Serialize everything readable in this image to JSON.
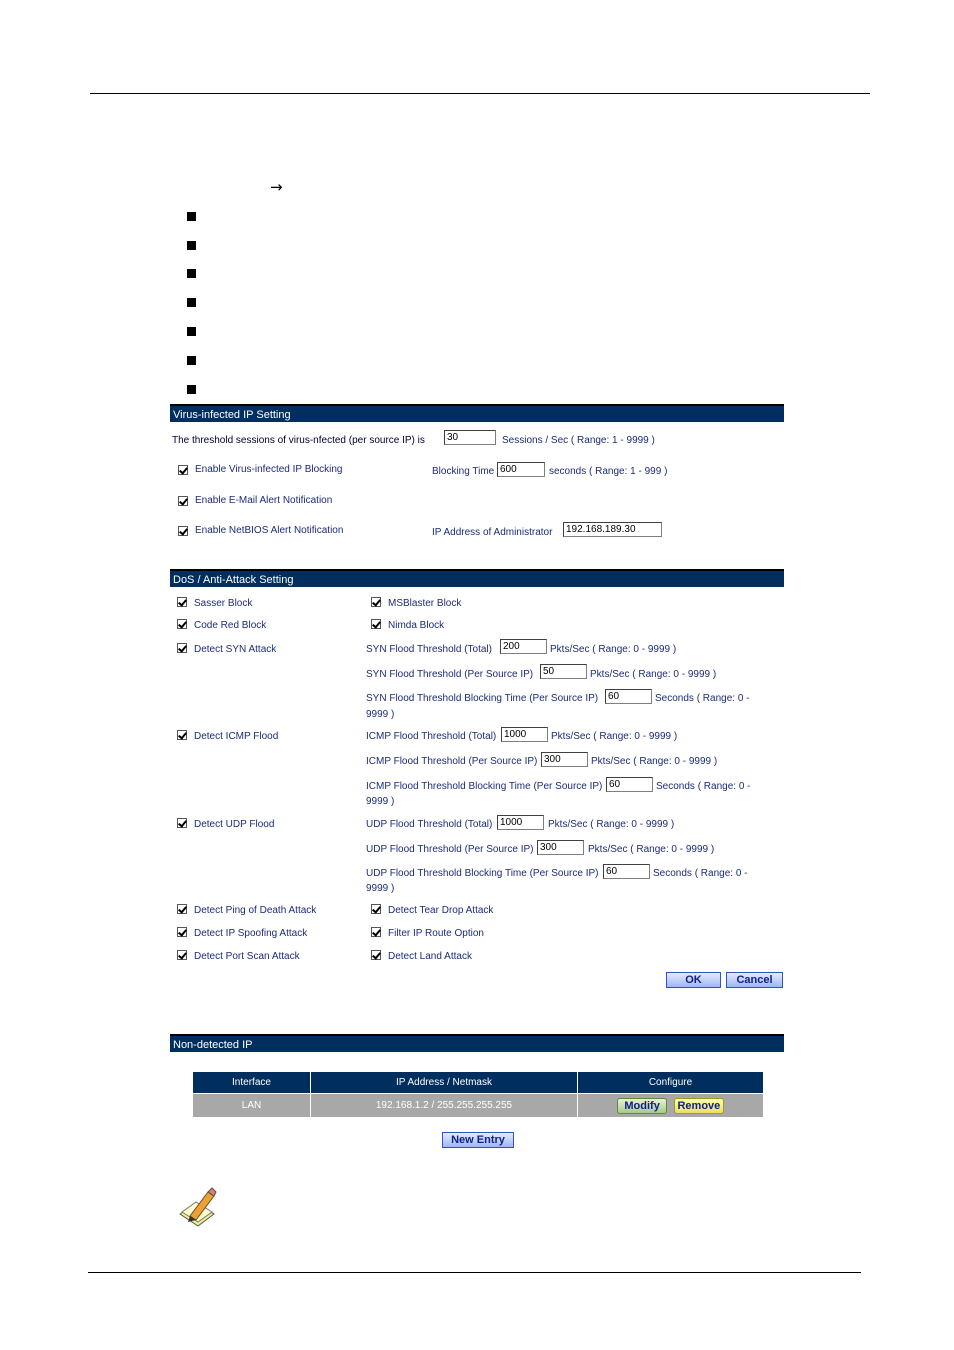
{
  "doc": {
    "arrow_icon": "right-arrow",
    "bullet_count": 7,
    "note_icon": "pencil-note-icon"
  },
  "virus": {
    "header": "Virus-infected IP Setting",
    "threshold_label": "The threshold sessions of virus-nfected (per source IP) is",
    "threshold_value": "30",
    "threshold_unit": "Sessions / Sec  ( Range: 1 - 9999 )",
    "blocking_label": "Enable Virus-infected IP Blocking",
    "blocking_checked": true,
    "blocking_time_label": "Blocking Time",
    "blocking_time_value": "600",
    "blocking_time_unit": "seconds  ( Range: 1 - 999 )",
    "email_label": "Enable E-Mail Alert Notification",
    "email_checked": true,
    "netbios_label": "Enable NetBIOS Alert Notification",
    "netbios_checked": true,
    "admin_ip_label": "IP Address of Administrator",
    "admin_ip_value": "192.168.189.30"
  },
  "dos": {
    "header": "DoS / Anti-Attack Setting",
    "sasser": "Sasser Block",
    "msblaster": "MSBlaster Block",
    "codered": "Code Red Block",
    "nimda": "Nimda Block",
    "syn": {
      "label": "Detect SYN Attack",
      "total_label": "SYN Flood Threshold (Total)",
      "total_value": "200",
      "total_unit": "Pkts/Sec  ( Range: 0 - 9999 )",
      "per_label": "SYN Flood Threshold (Per Source IP)",
      "per_value": "50",
      "per_unit": "Pkts/Sec  ( Range: 0 - 9999 )",
      "block_label": "SYN Flood Threshold Blocking Time (Per Source IP)",
      "block_value": "60",
      "block_unit": "Seconds  ( Range: 0 -",
      "block_unit2": "9999 )"
    },
    "icmp": {
      "label": "Detect ICMP Flood",
      "total_label": "ICMP Flood Threshold (Total)",
      "total_value": "1000",
      "total_unit": "Pkts/Sec  ( Range: 0 - 9999 )",
      "per_label": "ICMP Flood Threshold (Per Source IP)",
      "per_value": "300",
      "per_unit": "Pkts/Sec  ( Range: 0 - 9999 )",
      "block_label": "ICMP Flood Threshold Blocking Time (Per Source IP)",
      "block_value": "60",
      "block_unit": "Seconds  ( Range: 0 -",
      "block_unit2": "9999 )"
    },
    "udp": {
      "label": "Detect UDP Flood",
      "total_label": "UDP Flood Threshold (Total)",
      "total_value": "1000",
      "total_unit": "Pkts/Sec  ( Range: 0 - 9999 )",
      "per_label": "UDP Flood Threshold (Per Source IP)",
      "per_value": "300",
      "per_unit": "Pkts/Sec  ( Range: 0 - 9999 )",
      "block_label": "UDP Flood Threshold Blocking Time (Per Source IP)",
      "block_value": "60",
      "block_unit": "Seconds  ( Range: 0 -",
      "block_unit2": "9999 )"
    },
    "ping_death": "Detect Ping of Death Attack",
    "tear_drop": "Detect Tear Drop Attack",
    "ip_spoof": "Detect IP Spoofing Attack",
    "ip_route": "Filter IP Route Option",
    "port_scan": "Detect Port Scan Attack",
    "land": "Detect Land Attack",
    "ok": "OK",
    "cancel": "Cancel"
  },
  "nondetected": {
    "header": "Non-detected IP",
    "columns": [
      "Interface",
      "IP Address / Netmask",
      "Configure"
    ],
    "rows": [
      {
        "interface": "LAN",
        "address": "192.168.1.2 / 255.255.255.255",
        "modify": "Modify",
        "remove": "Remove"
      }
    ],
    "new_entry": "New Entry"
  }
}
